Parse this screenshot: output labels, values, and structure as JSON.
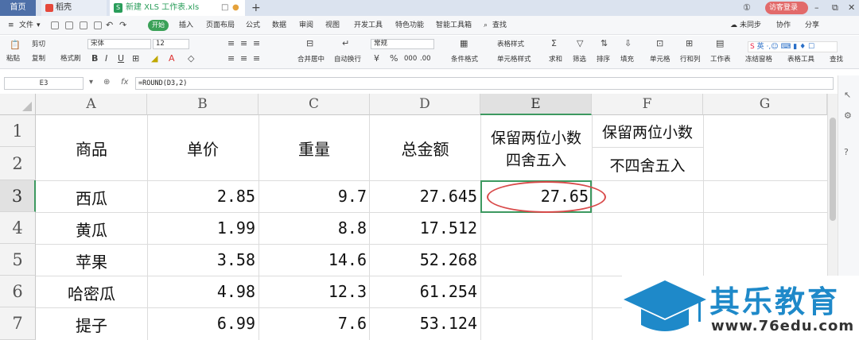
{
  "tabs": {
    "home": "首页",
    "daoke": "稻壳",
    "file": "新建 XLS 工作表.xls"
  },
  "window": {
    "guest_login": "访客登录"
  },
  "menu": {
    "file": "文件",
    "items": [
      "开始",
      "插入",
      "页面布局",
      "公式",
      "数据",
      "审阅",
      "视图",
      "开发工具",
      "特色功能",
      "智能工具箱"
    ],
    "search": "查找",
    "sync": "未同步",
    "collab": "协作",
    "share": "分享"
  },
  "ribbon": {
    "paste": "粘贴",
    "cut": "剪切",
    "copy": "复制",
    "format_painter": "格式刷",
    "font_name": "宋体",
    "font_size": "12",
    "number_format": "常规",
    "merge_center": "合并居中",
    "wrap": "自动换行",
    "cond_format": "条件格式",
    "table_style": "表格样式",
    "cell_style": "单元格样式",
    "sum": "求和",
    "filter": "筛选",
    "sort": "排序",
    "fill": "填充",
    "cell": "单元格",
    "rowcol": "行和列",
    "worksheet": "工作表",
    "freeze": "冻结窗格",
    "table_tools": "表格工具",
    "find": "查找"
  },
  "ime": {
    "label": "英"
  },
  "formula_bar": {
    "cell_ref": "E3",
    "fx": "fx",
    "formula": "=ROUND(D3,2)"
  },
  "sheet": {
    "columns": [
      "A",
      "B",
      "C",
      "D",
      "E",
      "F",
      "G"
    ],
    "rows": [
      "1",
      "2",
      "3",
      "4",
      "5",
      "6",
      "7"
    ],
    "selected_column": "E",
    "selected_row": "3",
    "headers": {
      "a": "商品",
      "b": "单价",
      "c": "重量",
      "d": "总金额",
      "e_line1": "保留两位小数",
      "e_line2": "四舍五入",
      "f_line1": "保留两位小数",
      "f_line2": "不四舍五入"
    },
    "data": [
      {
        "name": "西瓜",
        "price": "2.85",
        "weight": "9.7",
        "total": "27.645",
        "rounded": "27.65"
      },
      {
        "name": "黄瓜",
        "price": "1.99",
        "weight": "8.8",
        "total": "17.512",
        "rounded": ""
      },
      {
        "name": "苹果",
        "price": "3.58",
        "weight": "14.6",
        "total": "52.268",
        "rounded": ""
      },
      {
        "name": "哈密瓜",
        "price": "4.98",
        "weight": "12.3",
        "total": "61.254",
        "rounded": ""
      },
      {
        "name": "提子",
        "price": "6.99",
        "weight": "7.6",
        "total": "53.124",
        "rounded": ""
      }
    ]
  },
  "watermark": {
    "brand": "其乐教育",
    "url": "www.76edu.com"
  }
}
